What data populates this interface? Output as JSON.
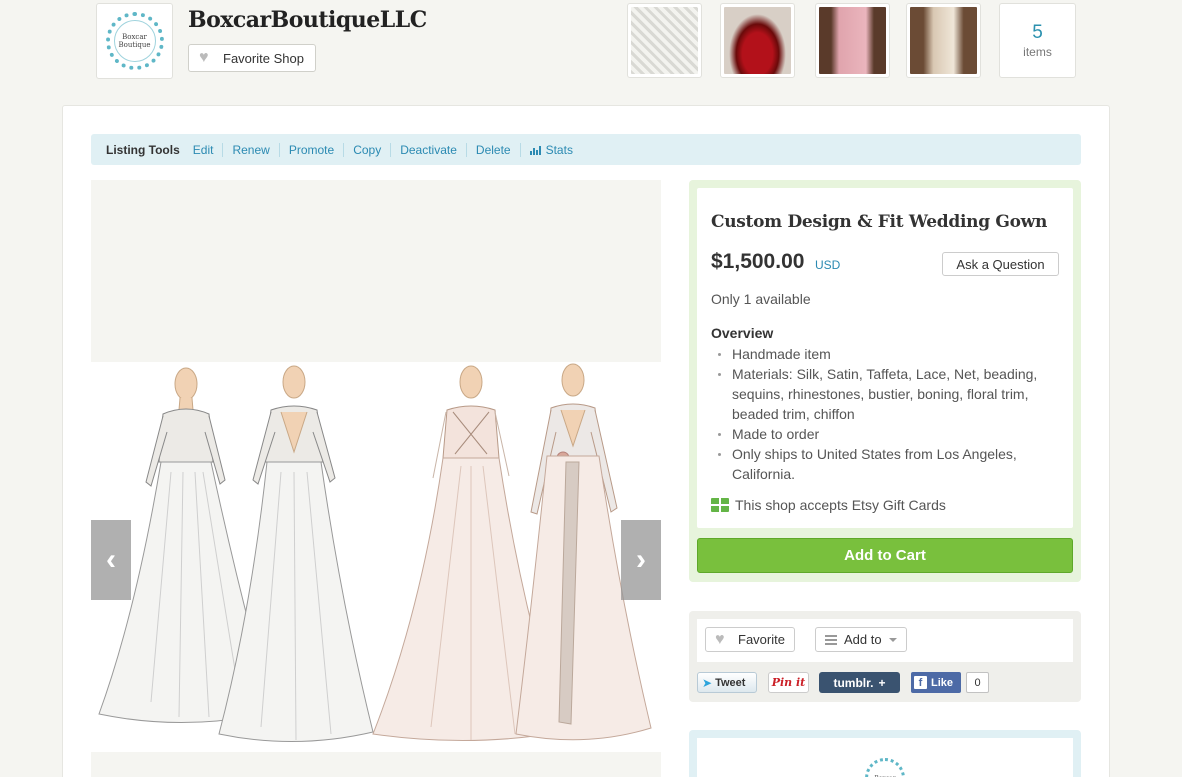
{
  "shop": {
    "name": "BoxcarBoutiqueLLC",
    "logo_line1": "Boxcar",
    "logo_line2": "Boutique",
    "favorite_label": "Favorite Shop",
    "items_count": "5",
    "items_label": "items"
  },
  "listing_tools": {
    "title": "Listing Tools",
    "links": [
      "Edit",
      "Renew",
      "Promote",
      "Copy",
      "Deactivate",
      "Delete",
      "Stats"
    ]
  },
  "listing": {
    "title": "Custom Design & Fit Wedding Gown",
    "price": "$1,500.00",
    "currency": "USD",
    "ask_label": "Ask a Question",
    "availability": "Only 1 available",
    "overview_title": "Overview",
    "overview": [
      "Handmade item",
      "Materials: Silk, Satin, Taffeta, Lace, Net, beading, sequins, rhinestones, bustier, boning, floral trim, beaded trim, chiffon",
      "Made to order",
      "Only ships to United States from Los Angeles, California."
    ],
    "gift_text": "This shop accepts Etsy Gift Cards",
    "add_to_cart": "Add to Cart"
  },
  "social": {
    "favorite": "Favorite",
    "add_to": "Add to",
    "tweet": "Tweet",
    "pinit": "Pin it",
    "tumblr": "tumblr.",
    "fb_like": "Like",
    "fb_count": "0"
  },
  "colors": {
    "accent": "#2b8ab2",
    "cart_green": "#79c03d",
    "card_green": "#e7f4dc",
    "tools_bg": "#e0f0f4"
  },
  "icons": {
    "heart": "heart-icon",
    "prev": "chevron-left-icon",
    "next": "chevron-right-icon",
    "stats": "bar-chart-icon",
    "gift": "gift-card-icon",
    "list": "list-icon"
  }
}
